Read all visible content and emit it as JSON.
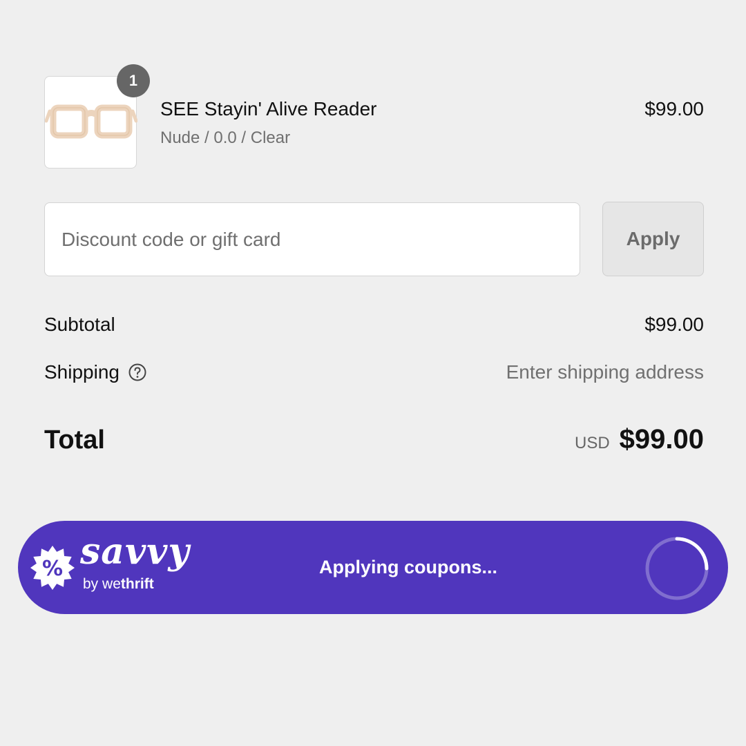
{
  "cart_item": {
    "quantity": "1",
    "name": "SEE Stayin' Alive Reader",
    "variant": "Nude / 0.0 / Clear",
    "price": "$99.00",
    "image_icon": "glasses-icon",
    "frame_color": "#efd8c1"
  },
  "discount": {
    "placeholder": "Discount code or gift card",
    "value": "",
    "apply_label": "Apply"
  },
  "summary": {
    "subtotal_label": "Subtotal",
    "subtotal_value": "$99.00",
    "shipping_label": "Shipping",
    "shipping_help_icon": "question-circle-icon",
    "shipping_value": "Enter shipping address",
    "total_label": "Total",
    "total_currency": "USD",
    "total_value": "$99.00"
  },
  "savvy": {
    "brand": "savvy",
    "byline_prefix": "by",
    "byline_we": "we",
    "byline_thrift": "thrift",
    "badge_icon": "percent-badge-icon",
    "status": "Applying coupons...",
    "spinner_icon": "loading-spinner-icon",
    "colors": {
      "bar": "#5036bd",
      "text": "#ffffff"
    }
  }
}
